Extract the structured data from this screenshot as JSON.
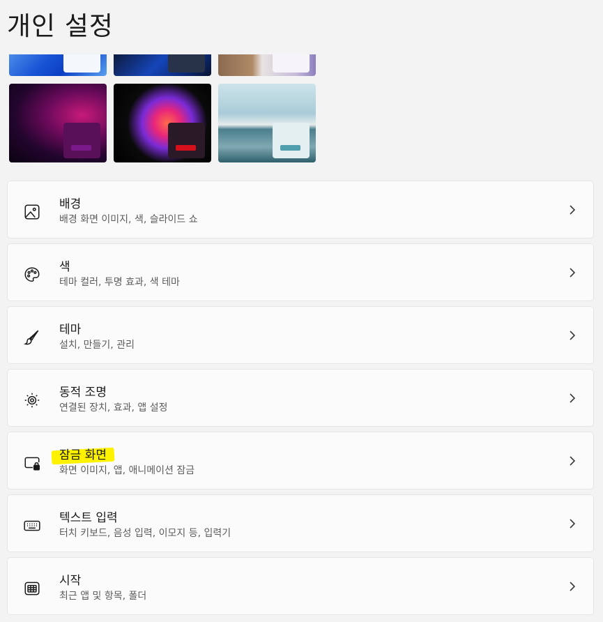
{
  "page": {
    "title": "개인 설정"
  },
  "themes": [
    {
      "name": "theme-windows-light",
      "window_color": "#f4f7fb",
      "bar_color": "#0a6fd6"
    },
    {
      "name": "theme-windows-dark",
      "window_color": "#28334a",
      "bar_color": "#1a8ae8"
    },
    {
      "name": "theme-glow",
      "window_color": "#f6f4f8",
      "bar_color": "#0a6fd6"
    },
    {
      "name": "theme-sunrise",
      "window_color": "#5a1058",
      "bar_color": "#7a1a8a"
    },
    {
      "name": "theme-flow",
      "window_color": "#2a1a28",
      "bar_color": "#d6101a"
    },
    {
      "name": "theme-captured-motion",
      "window_color": "#e4eff1",
      "bar_color": "#4f9fae"
    }
  ],
  "settings": [
    {
      "title": "배경",
      "subtitle": "배경 화면 이미지, 색, 슬라이드 쇼",
      "icon": "image-icon"
    },
    {
      "title": "색",
      "subtitle": "테마 컬러, 투명 효과, 색 테마",
      "icon": "palette-icon"
    },
    {
      "title": "테마",
      "subtitle": "설치, 만들기, 관리",
      "icon": "brush-icon"
    },
    {
      "title": "동적 조명",
      "subtitle": "연결된 장치, 효과, 앱 설정",
      "icon": "dynamic-lighting-icon"
    },
    {
      "title": "잠금 화면",
      "subtitle": "화면 이미지, 앱, 애니메이션 잠금",
      "icon": "lock-screen-icon",
      "highlight_color": "#fff200"
    },
    {
      "title": "텍스트 입력",
      "subtitle": "터치 키보드, 음성 입력, 이모지 등, 입력기",
      "icon": "keyboard-icon"
    },
    {
      "title": "시작",
      "subtitle": "최근 앱 및 항목, 폴더",
      "icon": "start-icon"
    }
  ]
}
